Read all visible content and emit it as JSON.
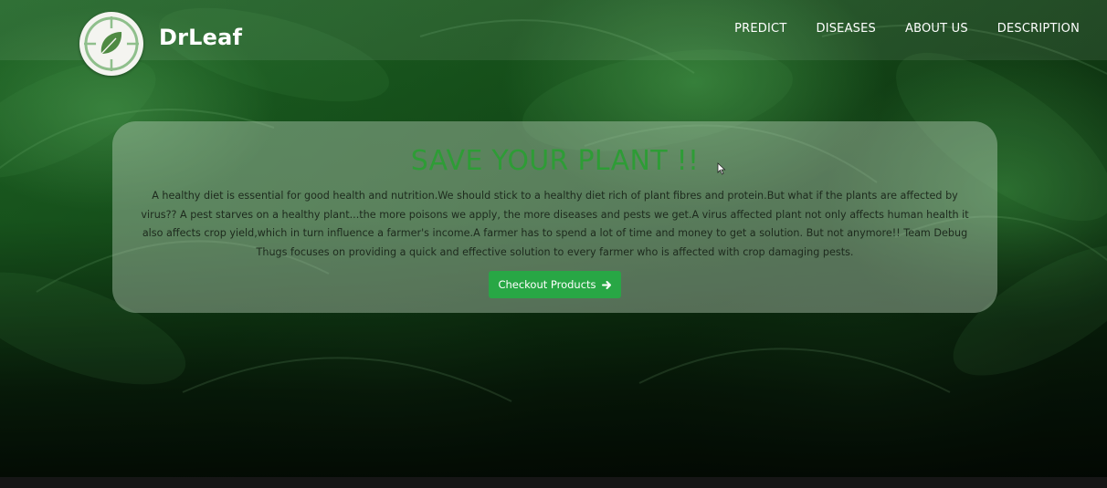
{
  "header": {
    "brand": "DrLeaf",
    "nav": [
      {
        "label": "PREDICT"
      },
      {
        "label": "DISEASES"
      },
      {
        "label": "ABOUT US"
      },
      {
        "label": "DESCRIPTION"
      }
    ]
  },
  "hero": {
    "title": "SAVE YOUR PLANT !!",
    "body": "A healthy diet is essential for good health and nutrition.We should stick to a healthy diet rich of plant fibres and protein.But what if the plants are affected by virus?? A pest starves on a healthy plant...the more poisons we apply, the more diseases and pests we get.A virus affected plant not only affects human health it also affects crop yield,which in turn influence a farmer's income.A farmer has to spend a lot of time and money to get a solution. But not anymore!! Team Debug Thugs focuses on providing a quick and effective solution to every farmer who is affected with crop damaging pests.",
    "cta_label": "Checkout Products",
    "cta_icon": "arrow-right-icon"
  },
  "colors": {
    "accent_green": "#28a745",
    "title_green": "#2e9c36"
  }
}
